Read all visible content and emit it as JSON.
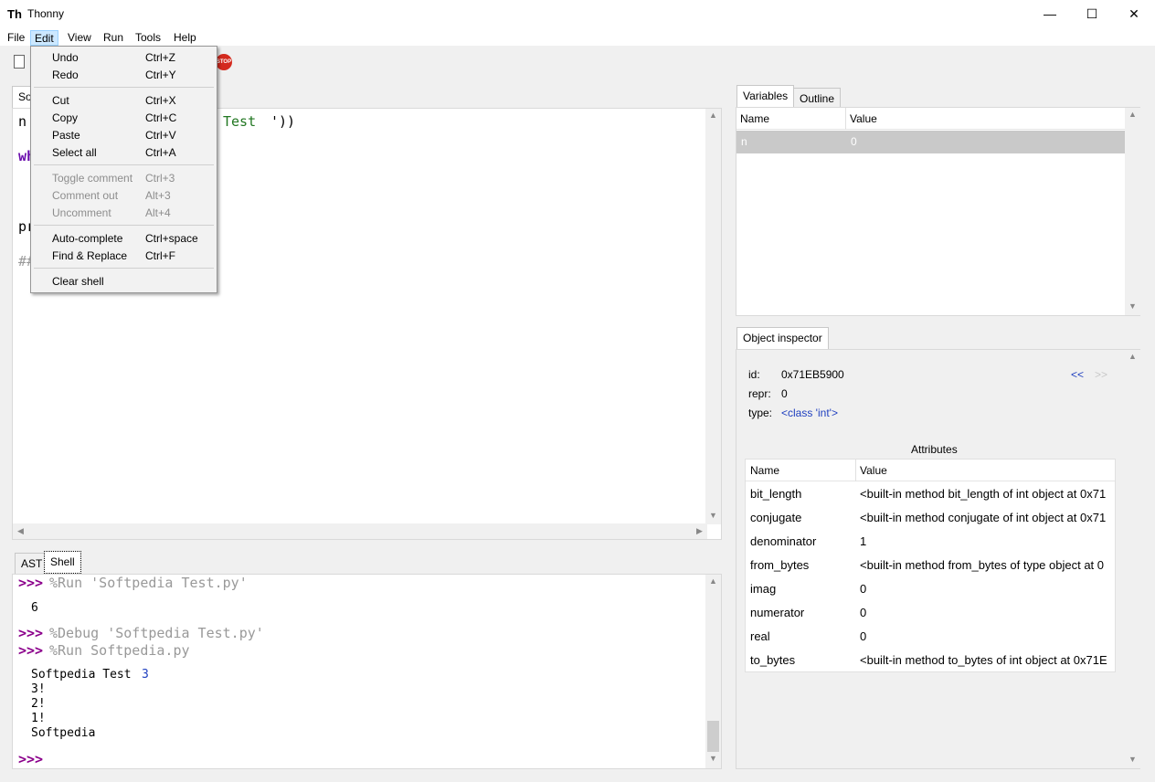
{
  "window": {
    "title": "Thonny",
    "minimize": "—",
    "maximize": "☐",
    "close": "✕"
  },
  "menubar": [
    "File",
    "Edit",
    "View",
    "Run",
    "Tools",
    "Help"
  ],
  "toolbar": {
    "stop_label": "STOP"
  },
  "editor": {
    "tab_label": "So",
    "lines": {
      "l1_a": "n",
      "l1_b": "Test ",
      "l1_c": "'))",
      "l2": "wh",
      "l3": "pr",
      "l4": "##"
    }
  },
  "bottom_tabs": [
    "AST",
    "Shell"
  ],
  "shell": {
    "prompt": ">>>",
    "cmd1": "%Run 'Softpedia Test.py'",
    "out1": "6",
    "cmd2": "%Debug 'Softpedia Test.py'",
    "cmd3": "%Run Softpedia.py",
    "out2_text": "Softpedia Test ",
    "out2_num": "3",
    "out3": "3!",
    "out4": "2!",
    "out5": "1!",
    "out6": "Softpedia"
  },
  "variables": {
    "tabs": [
      "Variables",
      "Outline"
    ],
    "col_name": "Name",
    "col_value": "Value",
    "rows": [
      {
        "name": "n",
        "value": "0"
      }
    ]
  },
  "inspector": {
    "tab_label": "Object inspector",
    "id_label": "id:",
    "id_value": "0x71EB5900",
    "repr_label": "repr:",
    "repr_value": "0",
    "type_label": "type:",
    "type_value": "<class 'int'>",
    "nav_back": "<<",
    "nav_fwd": ">>",
    "attributes_title": "Attributes",
    "col_name": "Name",
    "col_value": "Value",
    "attributes": [
      {
        "name": "bit_length",
        "value": "<built-in method bit_length of int object at 0x71"
      },
      {
        "name": "conjugate",
        "value": "<built-in method conjugate of int object at 0x71"
      },
      {
        "name": "denominator",
        "value": "1"
      },
      {
        "name": "from_bytes",
        "value": "<built-in method from_bytes of type object at 0"
      },
      {
        "name": "imag",
        "value": "0"
      },
      {
        "name": "numerator",
        "value": "0"
      },
      {
        "name": "real",
        "value": "0"
      },
      {
        "name": "to_bytes",
        "value": "<built-in method to_bytes of int object at 0x71E"
      }
    ]
  },
  "edit_menu": {
    "items": [
      {
        "label": "Undo",
        "accel": "Ctrl+Z"
      },
      {
        "label": "Redo",
        "accel": "Ctrl+Y"
      },
      {
        "label": "Cut",
        "accel": "Ctrl+X"
      },
      {
        "label": "Copy",
        "accel": "Ctrl+C"
      },
      {
        "label": "Paste",
        "accel": "Ctrl+V"
      },
      {
        "label": "Select all",
        "accel": "Ctrl+A"
      },
      {
        "label": "Toggle comment",
        "accel": "Ctrl+3"
      },
      {
        "label": "Comment out",
        "accel": "Alt+3"
      },
      {
        "label": "Uncomment",
        "accel": "Alt+4"
      },
      {
        "label": "Auto-complete",
        "accel": "Ctrl+space"
      },
      {
        "label": "Find & Replace",
        "accel": "Ctrl+F"
      },
      {
        "label": "Clear shell",
        "accel": ""
      }
    ]
  }
}
